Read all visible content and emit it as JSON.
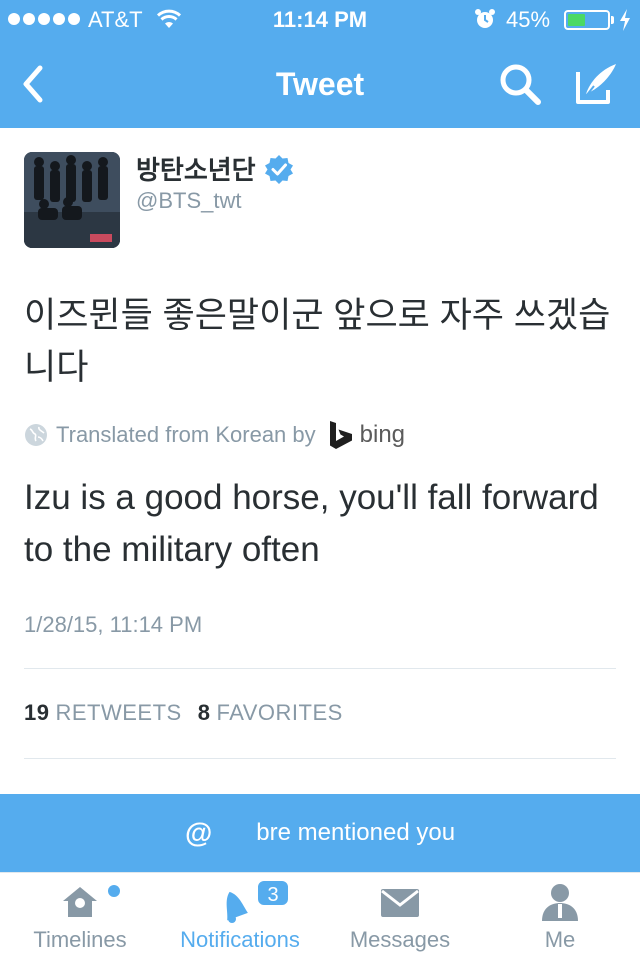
{
  "status_bar": {
    "carrier": "AT&T",
    "time": "11:14 PM",
    "battery_percent": "45%",
    "battery_level": 0.45,
    "signal_bars": 5
  },
  "nav": {
    "title": "Tweet",
    "icons": [
      "back-chevron-icon",
      "search-icon",
      "compose-icon"
    ]
  },
  "tweet": {
    "author_name": "방탄소년단",
    "author_handle": "@BTS_twt",
    "verified": true,
    "text": "이즈뮌들 좋은말이군 앞으로 자주 쓰겠습니다",
    "translated_from": "Translated from Korean by",
    "translator": "bing",
    "translation": "Izu is a good horse, you'll fall forward to the military often",
    "timestamp": "1/28/15, 11:14 PM",
    "retweets_count": "19",
    "retweets_label": "RETWEETS",
    "favorites_count": "8",
    "favorites_label": "FAVORITES"
  },
  "banner": {
    "icon": "@",
    "text": "bre mentioned you"
  },
  "tabs": [
    {
      "label": "Timelines",
      "icon": "home-icon",
      "active": false
    },
    {
      "label": "Notifications",
      "icon": "bell-icon",
      "active": true,
      "badge": "3"
    },
    {
      "label": "Messages",
      "icon": "envelope-icon",
      "active": false
    },
    {
      "label": "Me",
      "icon": "person-icon",
      "active": false
    }
  ],
  "colors": {
    "brand": "#55acee",
    "text": "#292f33",
    "muted": "#8899a6",
    "verified": "#55acee"
  }
}
